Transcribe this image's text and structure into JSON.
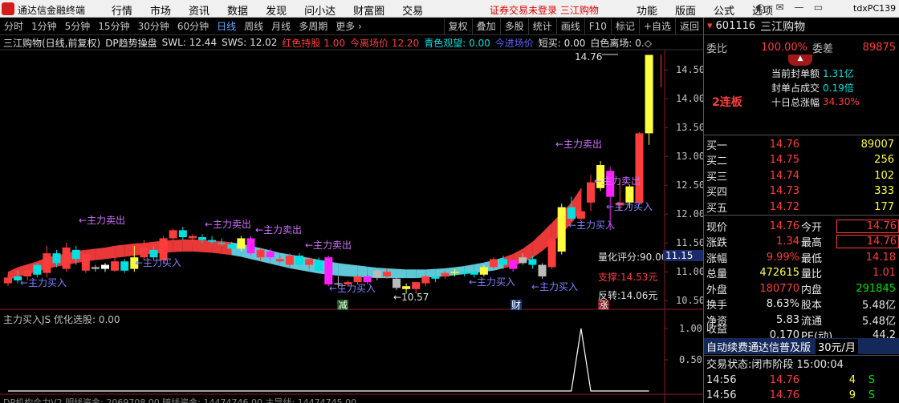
{
  "app": {
    "name": "通达信金融终端",
    "client_id": "tdxPC139"
  },
  "menu": [
    "行情",
    "市场",
    "资讯",
    "数据",
    "发现",
    "问小达",
    "财富圈",
    "交易"
  ],
  "notice": "证券交易未登录  三江购物",
  "menu_right": [
    "功能",
    "版面",
    "公式",
    "选项"
  ],
  "toolbar": {
    "periods": [
      "分时",
      "1分钟",
      "5分钟",
      "15分钟",
      "30分钟",
      "60分钟",
      "日线",
      "周线",
      "月线",
      "多周期",
      "更多"
    ],
    "active": "日线",
    "actions": [
      "复权",
      "叠加",
      "多股",
      "统计",
      "画线",
      "F10",
      "标记",
      "+自选",
      "返回"
    ]
  },
  "info": {
    "title": "三江购物(日线,前复权)",
    "indicator": "DP趋势操盘",
    "swl_label": "SWL:",
    "swl": "12.44",
    "sws_label": "SWS:",
    "sws": "12.02",
    "hold_label": "红色持股",
    "hold": "1.00",
    "leave_label": "今离场价",
    "leave": "12.20",
    "watch_label": "青色观望:",
    "watch": "0.00",
    "enter_label": "今进场价",
    "short_label": "短买:",
    "short": "0.00",
    "white_label": "白色离场:",
    "white": "0.◇"
  },
  "chart_data": {
    "type": "candlestick",
    "title": "三江购物(日线,前复权)",
    "y_ticks": [
      "14.50",
      "14.00",
      "13.50",
      "13.00",
      "12.50",
      "12.00",
      "11.50",
      "11.00",
      "10.50"
    ],
    "y_range": [
      10.35,
      14.85
    ],
    "candles": [
      [
        10.8,
        10.9,
        10.95,
        10.75
      ],
      [
        10.92,
        10.85,
        11.02,
        10.8
      ],
      [
        10.92,
        11.02,
        11.12,
        10.85
      ],
      [
        11.12,
        10.95,
        11.15,
        10.9
      ],
      [
        10.98,
        11.32,
        11.45,
        10.9
      ],
      [
        11.32,
        11.15,
        11.38,
        11.08
      ],
      [
        11.05,
        11.42,
        11.5,
        11.0
      ],
      [
        11.38,
        11.22,
        11.45,
        11.12
      ],
      [
        11.02,
        11.3,
        11.32,
        10.98
      ],
      [
        11.08,
        11.05,
        11.12,
        11.0
      ],
      [
        11.05,
        11.12,
        11.15,
        11.0
      ],
      [
        11.02,
        11.18,
        11.28,
        11.0
      ],
      [
        11.18,
        11.02,
        11.22,
        10.98
      ],
      [
        11.05,
        11.25,
        11.45,
        11.0
      ],
      [
        11.25,
        11.42,
        11.55,
        11.2
      ],
      [
        11.38,
        11.25,
        11.45,
        11.2
      ],
      [
        11.2,
        11.58,
        11.62,
        11.15
      ],
      [
        11.58,
        11.72,
        11.75,
        11.52
      ],
      [
        11.72,
        11.6,
        11.78,
        11.55
      ],
      [
        11.58,
        11.62,
        11.65,
        11.5
      ],
      [
        11.6,
        11.55,
        11.65,
        11.5
      ],
      [
        11.55,
        11.52,
        11.62,
        11.48
      ],
      [
        11.5,
        11.48,
        11.58,
        11.45
      ],
      [
        11.48,
        11.4,
        11.52,
        11.38
      ],
      [
        11.4,
        11.58,
        11.62,
        11.35
      ],
      [
        11.58,
        11.32,
        11.62,
        11.28
      ],
      [
        11.25,
        11.38,
        11.42,
        11.2
      ],
      [
        11.35,
        11.25,
        11.4,
        11.2
      ],
      [
        11.18,
        11.22,
        11.28,
        11.15
      ],
      [
        11.12,
        11.28,
        11.32,
        11.08
      ],
      [
        11.28,
        11.12,
        11.32,
        11.08
      ],
      [
        11.12,
        11.22,
        11.25,
        11.05
      ],
      [
        11.2,
        11.02,
        11.25,
        10.98
      ],
      [
        11.25,
        10.78,
        11.28,
        10.75
      ],
      [
        10.78,
        10.8,
        10.92,
        10.72
      ],
      [
        10.78,
        10.82,
        10.85,
        10.75
      ],
      [
        10.82,
        10.92,
        10.95,
        10.78
      ],
      [
        10.92,
        10.82,
        10.98,
        10.78
      ],
      [
        10.9,
        11.02,
        11.05,
        10.85
      ],
      [
        10.92,
        11.0,
        11.05,
        10.88
      ],
      [
        10.88,
        10.72,
        10.92,
        10.68
      ],
      [
        10.75,
        10.7,
        10.8,
        10.62
      ],
      [
        10.7,
        10.82,
        10.82,
        10.62
      ],
      [
        10.8,
        10.92,
        10.95,
        10.75
      ],
      [
        10.92,
        10.88,
        10.98,
        10.82
      ],
      [
        10.92,
        10.98,
        11.02,
        10.88
      ],
      [
        10.98,
        11.0,
        11.05,
        10.92
      ],
      [
        11.0,
        10.98,
        11.05,
        10.92
      ],
      [
        11.0,
        10.95,
        11.05,
        10.9
      ],
      [
        10.95,
        11.08,
        11.12,
        10.92
      ],
      [
        11.08,
        11.22,
        11.25,
        11.05
      ],
      [
        11.22,
        11.12,
        11.28,
        11.05
      ],
      [
        11.05,
        11.2,
        11.22,
        11.0
      ],
      [
        11.15,
        11.25,
        11.32,
        11.12
      ],
      [
        11.22,
        11.12,
        11.28,
        11.05
      ],
      [
        11.12,
        10.92,
        11.15,
        10.88
      ],
      [
        11.08,
        11.55,
        11.58,
        11.05
      ],
      [
        11.35,
        12.12,
        12.18,
        11.3
      ],
      [
        12.12,
        11.92,
        12.3,
        11.88
      ],
      [
        11.92,
        12.05,
        12.45,
        11.9
      ],
      [
        12.2,
        12.55,
        12.68,
        12.05
      ],
      [
        12.45,
        12.85,
        12.92,
        12.4
      ],
      [
        12.75,
        12.3,
        12.82,
        11.72
      ],
      [
        12.15,
        12.2,
        12.6,
        12.05
      ],
      [
        12.48,
        12.2,
        12.5,
        12.1
      ],
      [
        12.2,
        13.4,
        13.42,
        12.15
      ],
      [
        13.4,
        14.76,
        14.76,
        13.2
      ]
    ],
    "trend_upper": [
      11.0,
      11.08,
      11.13,
      11.18,
      11.25,
      11.28,
      11.32,
      11.36,
      11.38,
      11.4,
      11.42,
      11.45,
      11.47,
      11.49,
      11.5,
      11.52,
      11.54,
      11.55,
      11.56,
      11.56,
      11.55,
      11.54,
      11.53,
      11.51,
      11.48,
      11.45,
      11.41,
      11.37,
      11.33,
      11.3,
      11.27,
      11.24,
      11.21,
      11.18,
      11.15,
      11.13,
      11.11,
      11.09,
      11.07,
      11.06,
      11.05,
      11.04,
      11.04,
      11.04,
      11.05,
      11.06,
      11.08,
      11.1,
      11.13,
      11.16,
      11.2,
      11.25,
      11.31,
      11.4,
      11.52,
      11.68,
      11.85,
      12.02,
      12.2,
      12.45
    ],
    "trend_lower": [
      10.86,
      10.91,
      10.96,
      11.0,
      11.05,
      11.09,
      11.12,
      11.15,
      11.18,
      11.2,
      11.22,
      11.24,
      11.26,
      11.28,
      11.3,
      11.31,
      11.33,
      11.34,
      11.35,
      11.35,
      11.34,
      11.33,
      11.31,
      11.29,
      11.26,
      11.22,
      11.18,
      11.14,
      11.1,
      11.06,
      11.03,
      11.0,
      10.97,
      10.95,
      10.93,
      10.92,
      10.91,
      10.9,
      10.89,
      10.89,
      10.89,
      10.89,
      10.89,
      10.9,
      10.91,
      10.92,
      10.94,
      10.96,
      10.98,
      11.0,
      11.02,
      11.06,
      11.1,
      11.16,
      11.24,
      11.36,
      11.5,
      11.66,
      11.84,
      12.05
    ],
    "labels": {
      "sell": "←主力卖出",
      "buy": "←主力买入",
      "high": "14.76",
      "low": "←10.57",
      "score": "量化评分:90.00",
      "price_tag": "11.15",
      "support": "支撑:14.53元",
      "reversal": "反转:14.06元",
      "markers": [
        "减",
        "财",
        "涨"
      ]
    },
    "sub_chart": {
      "title": "主力买入JS  优化选股: 0.00",
      "y_ticks": [
        "1.00",
        "0.50"
      ],
      "values": [
        0,
        0,
        0,
        0,
        0,
        0,
        0,
        0,
        0,
        0,
        0,
        0,
        0,
        0,
        0,
        0,
        0,
        0,
        0,
        0,
        0,
        0,
        0,
        0,
        0,
        0,
        0,
        0,
        0,
        0,
        0,
        0,
        0,
        0,
        0,
        0,
        0,
        0,
        0,
        0,
        0,
        0,
        0,
        0,
        0,
        0,
        0,
        0,
        0,
        0,
        0,
        0,
        0,
        0,
        0,
        0,
        0,
        0,
        0,
        1,
        0,
        0,
        0,
        0,
        0,
        0,
        0
      ]
    },
    "bottom": {
      "text": "DP机构合力V2  明线资金: 2069708.00  暗线资金: 14474746.00  主导线: 14474745.00"
    }
  },
  "quote": {
    "code": "601116",
    "name": "三江购物",
    "webi_label": "委比",
    "webi": "100.00%",
    "weicha_label": "委差",
    "weicha": "89875",
    "seal_amt_label": "当前封单额",
    "seal_amt": "1.31亿",
    "seal_ratio_label": "封单占成交",
    "seal_ratio": "0.19倍",
    "ten_day_label": "十日总涨幅",
    "ten_day": "34.30%",
    "streak": "2连板",
    "bids": [
      {
        "l": "买一",
        "p": "14.76",
        "v": "89007"
      },
      {
        "l": "买二",
        "p": "14.75",
        "v": "256"
      },
      {
        "l": "买三",
        "p": "14.74",
        "v": "102"
      },
      {
        "l": "买四",
        "p": "14.73",
        "v": "333"
      },
      {
        "l": "买五",
        "p": "14.72",
        "v": "177"
      }
    ],
    "stats": [
      {
        "l1": "现价",
        "v1": "14.76",
        "l2": "今开",
        "v2": "14.76"
      },
      {
        "l1": "涨跌",
        "v1": "1.34",
        "l2": "最高",
        "v2": "14.76"
      },
      {
        "l1": "涨幅",
        "v1": "9.99%",
        "l2": "最低",
        "v2": "14.18"
      },
      {
        "l1": "总量",
        "v1": "472615",
        "l2": "量比",
        "v2": "1.01"
      },
      {
        "l1": "外盘",
        "v1": "180770",
        "l2": "内盘",
        "v2": "291845"
      },
      {
        "l1": "换手",
        "v1": "8.63%",
        "l2": "股本",
        "v2": "5.48亿"
      },
      {
        "l1": "净资",
        "v1": "5.83",
        "l2": "流通",
        "v2": "5.48亿"
      },
      {
        "l1": "收益(三)",
        "v1": "0.170",
        "l2": "PE(动)",
        "v2": "44.2"
      }
    ],
    "ad": "自动续费通达信普及版",
    "ad_price": "30元/月",
    "status_label": "交易状态:",
    "status": "闭市阶段 15:00:04",
    "ticks": [
      {
        "t": "14:56",
        "p": "14.76",
        "v": "4",
        "d": "S"
      },
      {
        "t": "14:56",
        "p": "14.76",
        "v": "9",
        "d": "S"
      }
    ]
  },
  "colors": {
    "up": "#ff3c3c",
    "down": "#00e0e0",
    "trend_red": "#e83838",
    "trend_cyan": "#5ec8d8",
    "magenta": "#ff20ff",
    "yellow": "#ffff40",
    "white": "#ffffff",
    "gray": "#bbbbbb",
    "label_blue": "#8080ff",
    "label_purple": "#d070ff"
  }
}
